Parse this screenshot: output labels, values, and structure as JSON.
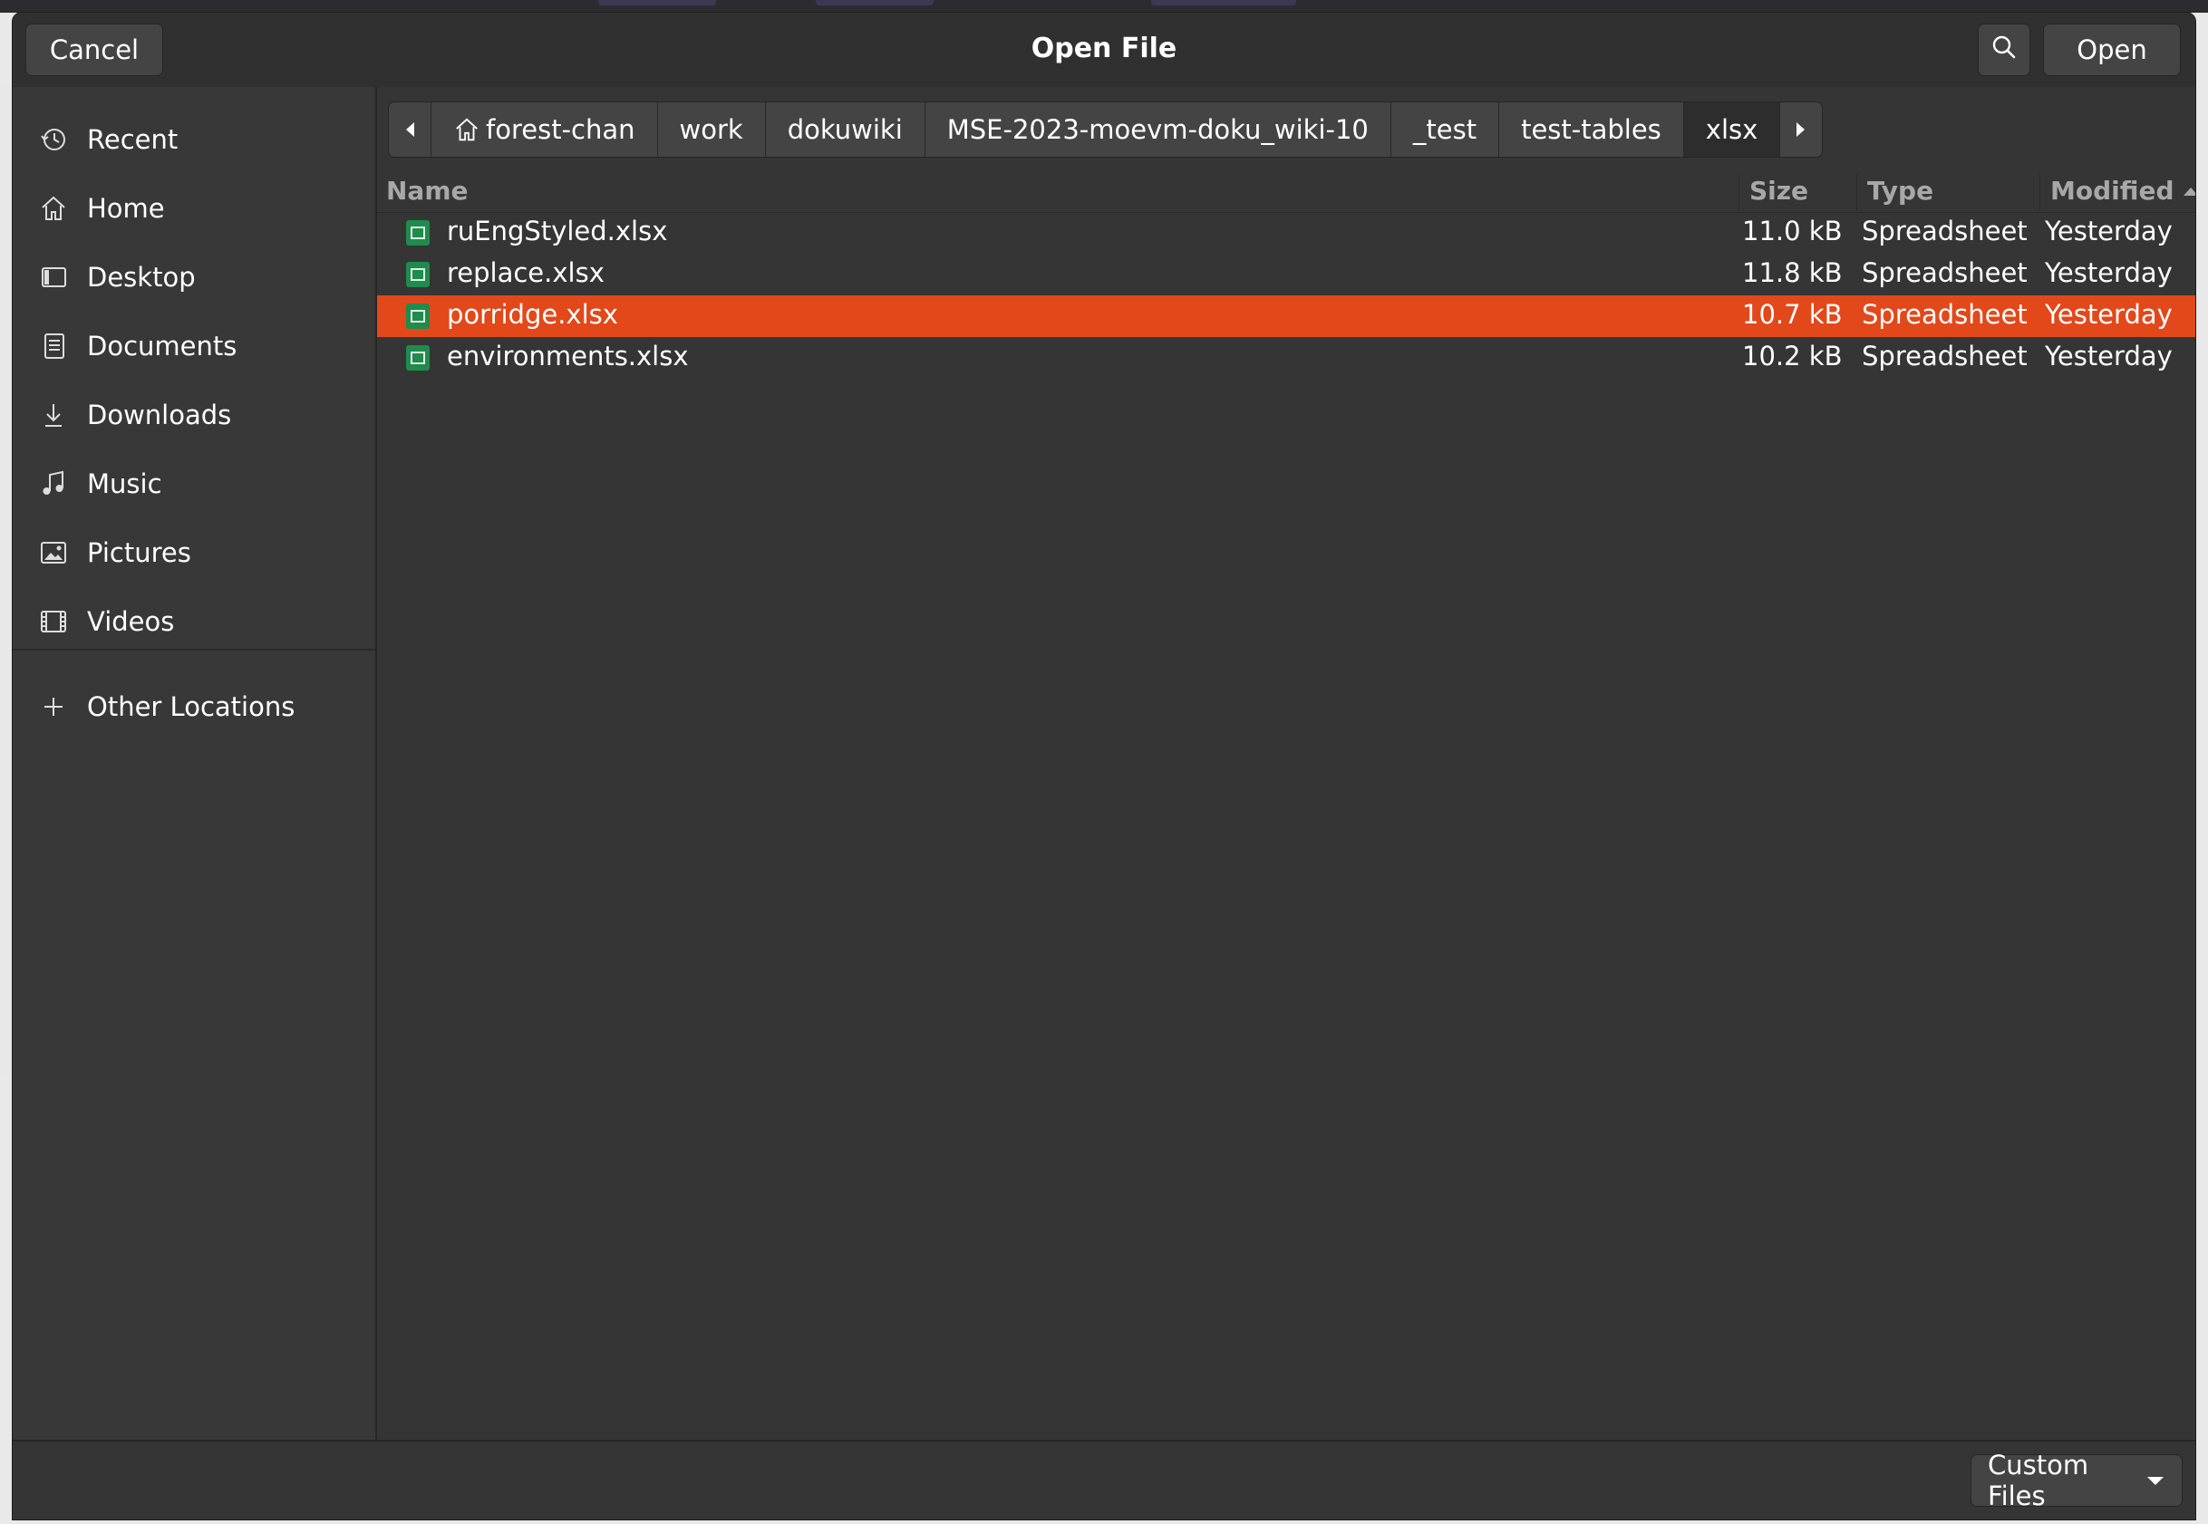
{
  "dialog": {
    "title": "Open File",
    "cancel_label": "Cancel",
    "open_label": "Open",
    "search_icon": "search-icon"
  },
  "sidebar": {
    "items": [
      {
        "label": "Recent",
        "icon": "clock-icon"
      },
      {
        "label": "Home",
        "icon": "home-icon"
      },
      {
        "label": "Desktop",
        "icon": "desktop-icon"
      },
      {
        "label": "Documents",
        "icon": "document-icon"
      },
      {
        "label": "Downloads",
        "icon": "download-icon"
      },
      {
        "label": "Music",
        "icon": "music-icon"
      },
      {
        "label": "Pictures",
        "icon": "picture-icon"
      },
      {
        "label": "Videos",
        "icon": "video-icon"
      }
    ],
    "other_locations": {
      "label": "Other Locations",
      "icon": "plus-icon"
    }
  },
  "pathbar": {
    "crumbs": [
      "forest-chan",
      "work",
      "dokuwiki",
      "MSE-2023-moevm-doku_wiki-10",
      "_test",
      "test-tables",
      "xlsx"
    ],
    "active_index": 6
  },
  "columns": {
    "name": "Name",
    "size": "Size",
    "type": "Type",
    "modified": "Modified"
  },
  "files": [
    {
      "name": "ruEngStyled.xlsx",
      "size": "11.0 kB",
      "type": "Spreadsheet",
      "modified": "Yesterday",
      "selected": false
    },
    {
      "name": "replace.xlsx",
      "size": "11.8 kB",
      "type": "Spreadsheet",
      "modified": "Yesterday",
      "selected": false
    },
    {
      "name": "porridge.xlsx",
      "size": "10.7 kB",
      "type": "Spreadsheet",
      "modified": "Yesterday",
      "selected": true
    },
    {
      "name": "environments.xlsx",
      "size": "10.2 kB",
      "type": "Spreadsheet",
      "modified": "Yesterday",
      "selected": false
    }
  ],
  "footer": {
    "filter_label": "Custom Files"
  },
  "colors": {
    "accent": "#e2481a",
    "background": "#353535",
    "spreadsheet_icon": "#1f8b4c"
  }
}
